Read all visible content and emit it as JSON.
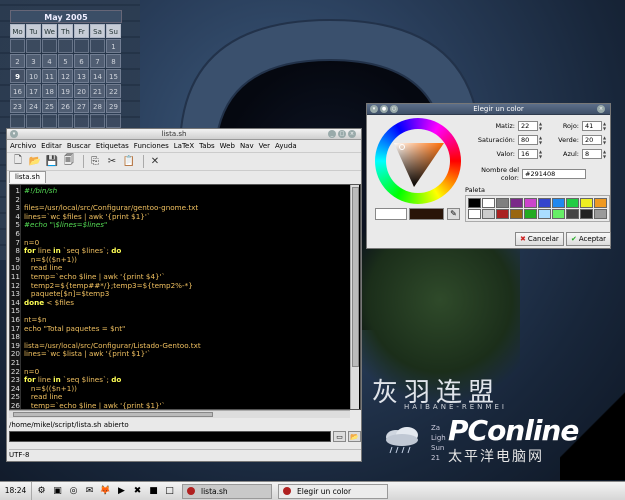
{
  "calendar": {
    "month_title": "May 2005",
    "weekdays": [
      "Mo",
      "Tu",
      "We",
      "Th",
      "Fr",
      "Sa",
      "Su"
    ],
    "days": [
      "",
      "",
      "",
      "",
      "",
      "",
      "1",
      "2",
      "3",
      "4",
      "5",
      "6",
      "7",
      "8",
      "9",
      "10",
      "11",
      "12",
      "13",
      "14",
      "15",
      "16",
      "17",
      "18",
      "19",
      "20",
      "21",
      "22",
      "23",
      "24",
      "25",
      "26",
      "27",
      "28",
      "29",
      "",
      "",
      "",
      "",
      "",
      "",
      ""
    ],
    "today": "9"
  },
  "editor": {
    "title": "lista.sh",
    "menu": [
      "Archivo",
      "Editar",
      "Buscar",
      "Etiquetas",
      "Funciones",
      "LaTeX",
      "Tabs",
      "Web",
      "Nav",
      "Ver",
      "Ayuda"
    ],
    "toolbar_icons": [
      "new-file-icon",
      "open-folder-icon",
      "save-icon",
      "save-all-icon",
      "copy-icon",
      "cut-icon",
      "paste-icon",
      "tools-icon"
    ],
    "tab": "lista.sh",
    "code_lines": [
      {
        "n": "1",
        "parts": [
          [
            "com",
            "#!/bin/sh"
          ]
        ]
      },
      {
        "n": "2",
        "parts": []
      },
      {
        "n": "3",
        "parts": [
          [
            "plain",
            "files=/usr/local/src/Configurar/gentoo-gnome.txt"
          ]
        ]
      },
      {
        "n": "4",
        "parts": [
          [
            "plain",
            "lines=`wc $files | awk '{print $1}'`"
          ]
        ]
      },
      {
        "n": "5",
        "parts": [
          [
            "com",
            "#echo \"\\$lines=$lines\""
          ]
        ]
      },
      {
        "n": "6",
        "parts": []
      },
      {
        "n": "7",
        "parts": [
          [
            "plain",
            "n=0"
          ]
        ]
      },
      {
        "n": "8",
        "parts": [
          [
            "kw",
            "for"
          ],
          [
            "plain",
            " line "
          ],
          [
            "kw",
            "in"
          ],
          [
            "plain",
            " `seq $lines`; "
          ],
          [
            "kw",
            "do"
          ]
        ]
      },
      {
        "n": "9",
        "parts": [
          [
            "plain",
            "   n=$(($n+1))"
          ]
        ]
      },
      {
        "n": "10",
        "parts": [
          [
            "plain",
            "   read line"
          ]
        ]
      },
      {
        "n": "11",
        "parts": [
          [
            "plain",
            "   temp=`echo $line | awk '{print $4}'`"
          ]
        ]
      },
      {
        "n": "12",
        "parts": [
          [
            "plain",
            "   temp2=${temp##*/};temp3=${temp2%-*}"
          ]
        ]
      },
      {
        "n": "13",
        "parts": [
          [
            "plain",
            "   paquete[$n]=$temp3"
          ]
        ]
      },
      {
        "n": "14",
        "parts": [
          [
            "kw",
            "done"
          ],
          [
            "plain",
            " < $files"
          ]
        ]
      },
      {
        "n": "15",
        "parts": []
      },
      {
        "n": "16",
        "parts": [
          [
            "plain",
            "nt=$n"
          ]
        ]
      },
      {
        "n": "17",
        "parts": [
          [
            "plain",
            "echo \"Total paquetes = $nt\""
          ]
        ]
      },
      {
        "n": "18",
        "parts": []
      },
      {
        "n": "19",
        "parts": [
          [
            "plain",
            "lista=/usr/local/src/Configurar/Listado-Gentoo.txt"
          ]
        ]
      },
      {
        "n": "20",
        "parts": [
          [
            "plain",
            "lines=`wc $lista | awk '{print $1}'`"
          ]
        ]
      },
      {
        "n": "21",
        "parts": []
      },
      {
        "n": "22",
        "parts": [
          [
            "plain",
            "n=0"
          ]
        ]
      },
      {
        "n": "23",
        "parts": [
          [
            "kw",
            "for"
          ],
          [
            "plain",
            " line "
          ],
          [
            "kw",
            "in"
          ],
          [
            "plain",
            " `seq $lines`; "
          ],
          [
            "kw",
            "do"
          ]
        ]
      },
      {
        "n": "24",
        "parts": [
          [
            "plain",
            "   n=$(($n+1))"
          ]
        ]
      },
      {
        "n": "25",
        "parts": [
          [
            "plain",
            "   read line"
          ]
        ]
      },
      {
        "n": "26",
        "parts": [
          [
            "plain",
            "   temp=`echo $line | awk '{print $1}'`"
          ]
        ]
      }
    ],
    "output_text": "/home/mikel/script/lista.sh abierto",
    "status": "UTF-8"
  },
  "color_dialog": {
    "title": "Elegir un color",
    "fields_left": [
      {
        "label": "Matiz:",
        "value": "22"
      },
      {
        "label": "Saturación:",
        "value": "80"
      },
      {
        "label": "Valor:",
        "value": "16"
      }
    ],
    "fields_right": [
      {
        "label": "Rojo:",
        "value": "41"
      },
      {
        "label": "Verde:",
        "value": "20"
      },
      {
        "label": "Azul:",
        "value": "8"
      }
    ],
    "hex_label": "Nombre del color:",
    "hex_value": "#291408",
    "palette_label": "Paleta",
    "palette_colors": [
      "#000000",
      "#ffffff",
      "#808080",
      "#7a2a88",
      "#cc44cc",
      "#3344cc",
      "#2288ee",
      "#22cc44",
      "#eeee22",
      "#ee9922",
      "#ffffff",
      "#cccccc",
      "#aa2222",
      "#996611",
      "#22aa22",
      "#aaddff",
      "#66ee66",
      "#444444",
      "#222222",
      "#999999"
    ],
    "current_color": "#ffffff",
    "previous_color": "#291408",
    "cancel_label": "Cancelar",
    "accept_label": "Aceptar"
  },
  "desktop": {
    "watermark_cn": "灰羽连盟",
    "watermark_sub": "HAIBANE-RENMEI",
    "brand": "PConline",
    "brand_cn": "太平洋电脑网",
    "weather_lines": [
      "Za",
      "Ligh",
      "Sun",
      "21"
    ]
  },
  "taskbar": {
    "clock": "18:24",
    "tasks": [
      {
        "label": "lista.sh",
        "active": true
      },
      {
        "label": "Elegir un color",
        "active": false
      }
    ]
  }
}
